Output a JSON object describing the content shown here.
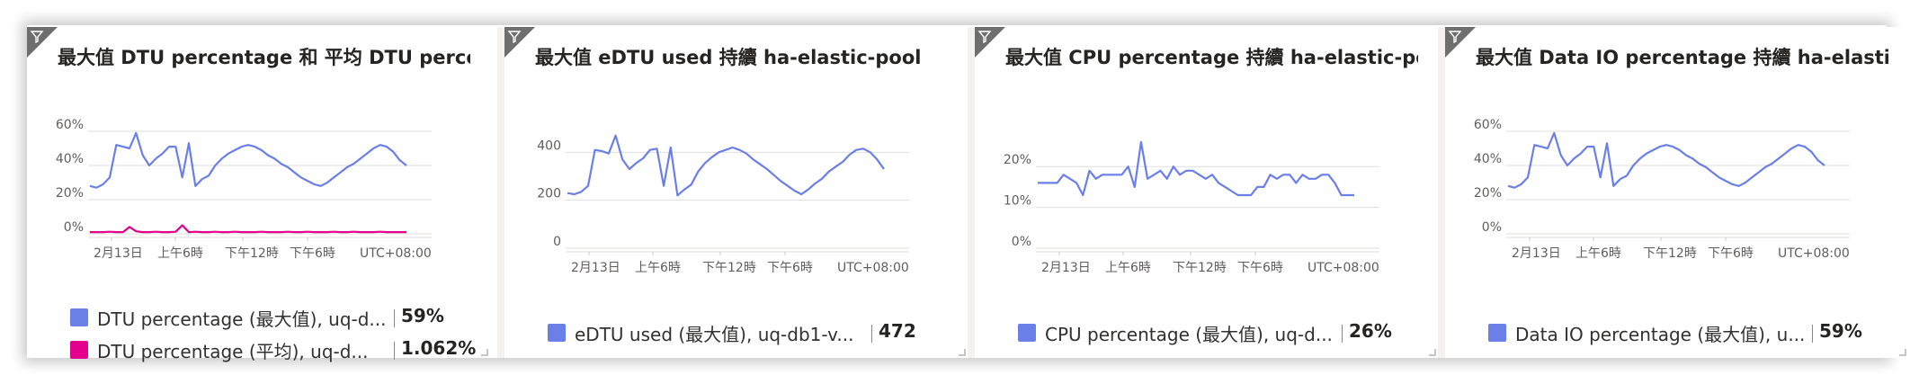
{
  "tiles": [
    {
      "title": "最大值 DTU percentage 和 平均 DTU percen...",
      "legend": [
        {
          "name": "DTU percentage (最大值), uq-d...",
          "value": "59%"
        },
        {
          "name": "DTU percentage (平均), uq-d...",
          "value": "1.062%"
        }
      ]
    },
    {
      "title": "最大值 eDTU used 持續 ha-elastic-pool",
      "legend": [
        {
          "name": "eDTU used (最大值), uq-db1-v...",
          "value": "472"
        }
      ]
    },
    {
      "title": "最大值 CPU percentage 持續 ha-elastic-pool",
      "legend": [
        {
          "name": "CPU percentage (最大值), uq-d...",
          "value": "26%"
        }
      ]
    },
    {
      "title": "最大值 Data IO percentage 持續 ha-elastic-...",
      "legend": [
        {
          "name": "Data IO percentage (最大值), u...",
          "value": "59%"
        }
      ]
    }
  ],
  "colors": {
    "blue": "#6b7fe8",
    "magenta": "#e3008c",
    "grid": "#e1dfdd",
    "text": "#605e5c"
  },
  "icons": {
    "filter": "filter-icon"
  },
  "chart_data": [
    {
      "type": "line",
      "x_tick_labels": [
        "2月13日",
        "上午6時",
        "下午12時",
        "下午6時",
        "UTC+08:00"
      ],
      "y_tick_labels": [
        "0%",
        "20%",
        "40%",
        "60%"
      ],
      "ylim": [
        0,
        60
      ],
      "grid": true,
      "series": [
        {
          "name": "DTU percentage (最大值), uq-d...",
          "color": "#6b7fe8",
          "values": [
            28,
            27,
            29,
            33,
            52,
            51,
            50,
            59,
            46,
            40,
            44,
            47,
            51,
            51,
            33,
            53,
            28,
            32,
            34,
            40,
            44,
            47,
            49,
            51,
            52,
            51,
            49,
            46,
            44,
            41,
            39,
            36,
            33,
            31,
            29,
            28,
            30,
            33,
            36,
            39,
            41,
            44,
            47,
            50,
            52,
            51,
            48,
            43,
            40
          ]
        },
        {
          "name": "DTU percentage (平均), uq-d...",
          "color": "#e3008c",
          "values": [
            1,
            1,
            1,
            1.2,
            1,
            1,
            4,
            1.5,
            1,
            1,
            1.2,
            1,
            1,
            1.2,
            5,
            1,
            1.2,
            1,
            1,
            1.2,
            1,
            1,
            1.2,
            1,
            1,
            1,
            1.2,
            1,
            1,
            1,
            1.2,
            1,
            1,
            1.2,
            1,
            1,
            1,
            1.2,
            1,
            1,
            1.2,
            1,
            1,
            1,
            1.2,
            1,
            1,
            1,
            1
          ]
        }
      ]
    },
    {
      "type": "line",
      "x_tick_labels": [
        "2月13日",
        "上午6時",
        "下午12時",
        "下午6時",
        "UTC+08:00"
      ],
      "y_tick_labels": [
        "0",
        "200",
        "400"
      ],
      "ylim": [
        0,
        480
      ],
      "grid": true,
      "series": [
        {
          "name": "eDTU used (最大值), uq-db1-v...",
          "color": "#6b7fe8",
          "values": [
            230,
            225,
            235,
            260,
            410,
            405,
            395,
            470,
            370,
            330,
            355,
            375,
            410,
            415,
            260,
            420,
            220,
            245,
            265,
            320,
            355,
            380,
            400,
            410,
            420,
            410,
            395,
            370,
            350,
            330,
            305,
            280,
            260,
            240,
            225,
            245,
            270,
            290,
            320,
            340,
            360,
            390,
            410,
            415,
            400,
            370,
            330
          ]
        }
      ]
    },
    {
      "type": "line",
      "x_tick_labels": [
        "2月13日",
        "上午6時",
        "下午12時",
        "下午6時",
        "UTC+08:00"
      ],
      "y_tick_labels": [
        "0%",
        "10%",
        "20%"
      ],
      "ylim": [
        0,
        26
      ],
      "grid": true,
      "series": [
        {
          "name": "CPU percentage (最大值), uq-d...",
          "color": "#6b7fe8",
          "values": [
            16,
            16,
            16,
            16,
            18,
            17,
            16,
            13,
            19,
            17,
            18,
            18,
            18,
            18,
            20,
            15,
            26,
            17,
            18,
            19,
            17,
            20,
            18,
            19,
            19,
            18,
            17,
            18,
            16,
            15,
            14,
            13,
            13,
            13,
            15,
            15,
            18,
            17,
            18,
            18,
            16,
            18,
            17,
            17,
            18,
            18,
            16,
            13,
            13,
            13
          ]
        }
      ]
    },
    {
      "type": "line",
      "x_tick_labels": [
        "2月13日",
        "上午6時",
        "下午12時",
        "下午6時",
        "UTC+08:00"
      ],
      "y_tick_labels": [
        "0%",
        "20%",
        "40%",
        "60%"
      ],
      "ylim": [
        0,
        60
      ],
      "grid": true,
      "series": [
        {
          "name": "Data IO percentage (最大值), u...",
          "color": "#6b7fe8",
          "values": [
            28,
            27,
            29,
            33,
            52,
            51,
            50,
            59,
            46,
            40,
            44,
            47,
            51,
            51,
            33,
            53,
            28,
            32,
            34,
            40,
            44,
            47,
            49,
            51,
            52,
            51,
            49,
            46,
            44,
            41,
            39,
            36,
            33,
            31,
            29,
            28,
            30,
            33,
            36,
            39,
            41,
            44,
            47,
            50,
            52,
            51,
            48,
            43,
            40
          ]
        }
      ]
    }
  ]
}
